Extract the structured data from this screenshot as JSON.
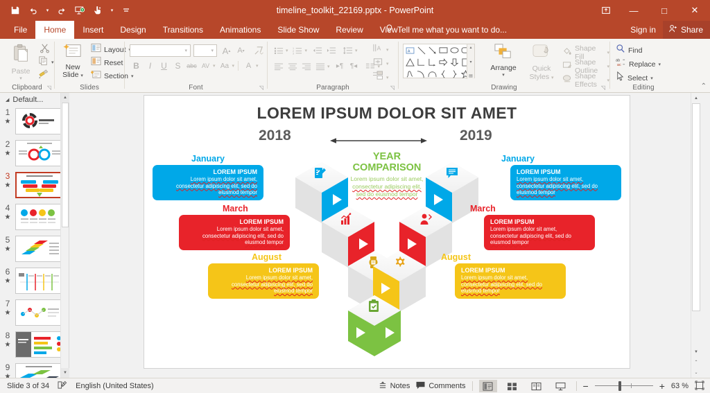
{
  "window": {
    "title": "timeline_toolkit_22169.pptx - PowerPoint",
    "quick_access": [
      {
        "name": "save",
        "glyph": "save-icon"
      },
      {
        "name": "undo",
        "glyph": "undo-icon"
      },
      {
        "name": "redo",
        "glyph": "redo-icon"
      },
      {
        "name": "start-from-beginning",
        "glyph": "slideshow-icon"
      },
      {
        "name": "touch-mouse-mode",
        "glyph": "touch-mode-icon"
      },
      {
        "name": "customize-quick-access-toolbar",
        "glyph": "more-icon"
      }
    ],
    "controls": {
      "ribbon_display_options": "ribbon-options-icon",
      "minimize": "—",
      "maximize": "□",
      "close": "✕"
    }
  },
  "ribbon_tabs": [
    {
      "label": "File",
      "active": false
    },
    {
      "label": "Home",
      "active": true
    },
    {
      "label": "Insert",
      "active": false
    },
    {
      "label": "Design",
      "active": false
    },
    {
      "label": "Transitions",
      "active": false
    },
    {
      "label": "Animations",
      "active": false
    },
    {
      "label": "Slide Show",
      "active": false
    },
    {
      "label": "Review",
      "active": false
    },
    {
      "label": "View",
      "active": false
    }
  ],
  "tell_me": "Tell me what you want to do...",
  "account": {
    "sign_in": "Sign in",
    "share": "Share"
  },
  "ribbon": {
    "clipboard": {
      "label": "Clipboard",
      "paste": "Paste",
      "cut": "Cut",
      "copy": "Copy",
      "format_painter": "Format Painter"
    },
    "slides": {
      "label": "Slides",
      "new_slide": "New\nSlide",
      "new_slide_line1": "New",
      "new_slide_line2": "Slide",
      "layout": "Layout",
      "reset": "Reset",
      "section": "Section"
    },
    "font": {
      "label": "Font",
      "font_name_value": "",
      "font_size_value": "",
      "increase_font": "A",
      "decrease_font": "A",
      "clear_formatting": "Clear All Formatting",
      "bold": "B",
      "italic": "I",
      "underline": "U",
      "shadow": "S",
      "strikethrough": "abc",
      "character_spacing": "AV",
      "change_case": "Aa",
      "font_color": "A"
    },
    "paragraph": {
      "label": "Paragraph",
      "bullets": "Bullets",
      "numbering": "Numbering",
      "decrease_indent": "Decrease List Level",
      "increase_indent": "Increase List Level",
      "line_spacing": "Line Spacing",
      "align_left": "Align Left",
      "center": "Center",
      "align_right": "Align Right",
      "justify": "Justify",
      "text_direction": "Text Direction",
      "align_text": "Align Text",
      "columns": "Columns",
      "convert_to_smartart": "Convert to SmartArt"
    },
    "drawing": {
      "label": "Drawing",
      "arrange": "Arrange",
      "quick_styles_line1": "Quick",
      "quick_styles_line2": "Styles",
      "shape_fill": "Shape Fill",
      "shape_outline": "Shape Outline",
      "shape_effects": "Shape Effects"
    },
    "editing": {
      "label": "Editing",
      "find": "Find",
      "replace": "Replace",
      "select": "Select"
    },
    "collapse": "Collapse the Ribbon"
  },
  "thumbnail_pane": {
    "section_name": "Default...",
    "slides": [
      {
        "number": "1",
        "selected": false
      },
      {
        "number": "2",
        "selected": false
      },
      {
        "number": "3",
        "selected": true
      },
      {
        "number": "4",
        "selected": false
      },
      {
        "number": "5",
        "selected": false
      },
      {
        "number": "6",
        "selected": false
      },
      {
        "number": "7",
        "selected": false
      },
      {
        "number": "8",
        "selected": false
      },
      {
        "number": "9",
        "selected": false
      }
    ]
  },
  "slide": {
    "title": "LOREM IPSUM DOLOR SIT AMET",
    "year_left": "2018",
    "year_right": "2019",
    "center": {
      "heading_line1": "YEAR",
      "heading_line2": "COMPARISON",
      "body_line1": "Lorem ipsum dolor sit amet,",
      "body_line2": "consectetur adipiscing elit,",
      "body_line3": "sed do eiusmod tempor"
    },
    "body_line1": "Lorem ipsum dolor sit amet,",
    "body_line2": "consectetur adipiscing elit, sed do",
    "body_line3": "eiusmod tempor",
    "entry_heading": "LOREM IPSUM",
    "left_entries": [
      {
        "month": "January",
        "color": "#00a8e8",
        "icon": "notes-pen-icon"
      },
      {
        "month": "March",
        "color": "#e8232a",
        "icon": "bar-chart-icon"
      },
      {
        "month": "August",
        "color": "#f5c518",
        "icon": "watch-icon"
      }
    ],
    "right_entries": [
      {
        "month": "January",
        "color": "#00a8e8",
        "icon": "chat-list-icon"
      },
      {
        "month": "March",
        "color": "#e8232a",
        "icon": "user-icon"
      },
      {
        "month": "August",
        "color": "#f5c518",
        "icon": "gear-icon"
      }
    ],
    "bottom_entry": {
      "color": "#7cc242",
      "icon": "clipboard-check-icon"
    },
    "colors": {
      "blue": "#00a8e8",
      "red": "#e8232a",
      "yellow": "#f5c518",
      "green": "#7cc242",
      "title_gray": "#3d3d3d"
    }
  },
  "status_bar": {
    "slide_counter": "Slide 3 of 34",
    "language": "English (United States)",
    "spellcheck_icon": "proofing-icon",
    "notes": "Notes",
    "comments": "Comments",
    "views": [
      {
        "name": "normal-view",
        "active": true
      },
      {
        "name": "slide-sorter-view",
        "active": false
      },
      {
        "name": "reading-view",
        "active": false
      },
      {
        "name": "slide-show-view",
        "active": false
      }
    ],
    "zoom_out": "−",
    "zoom_in": "+",
    "zoom_level": "63 %",
    "fit_to_window": "fit-slide-icon"
  }
}
